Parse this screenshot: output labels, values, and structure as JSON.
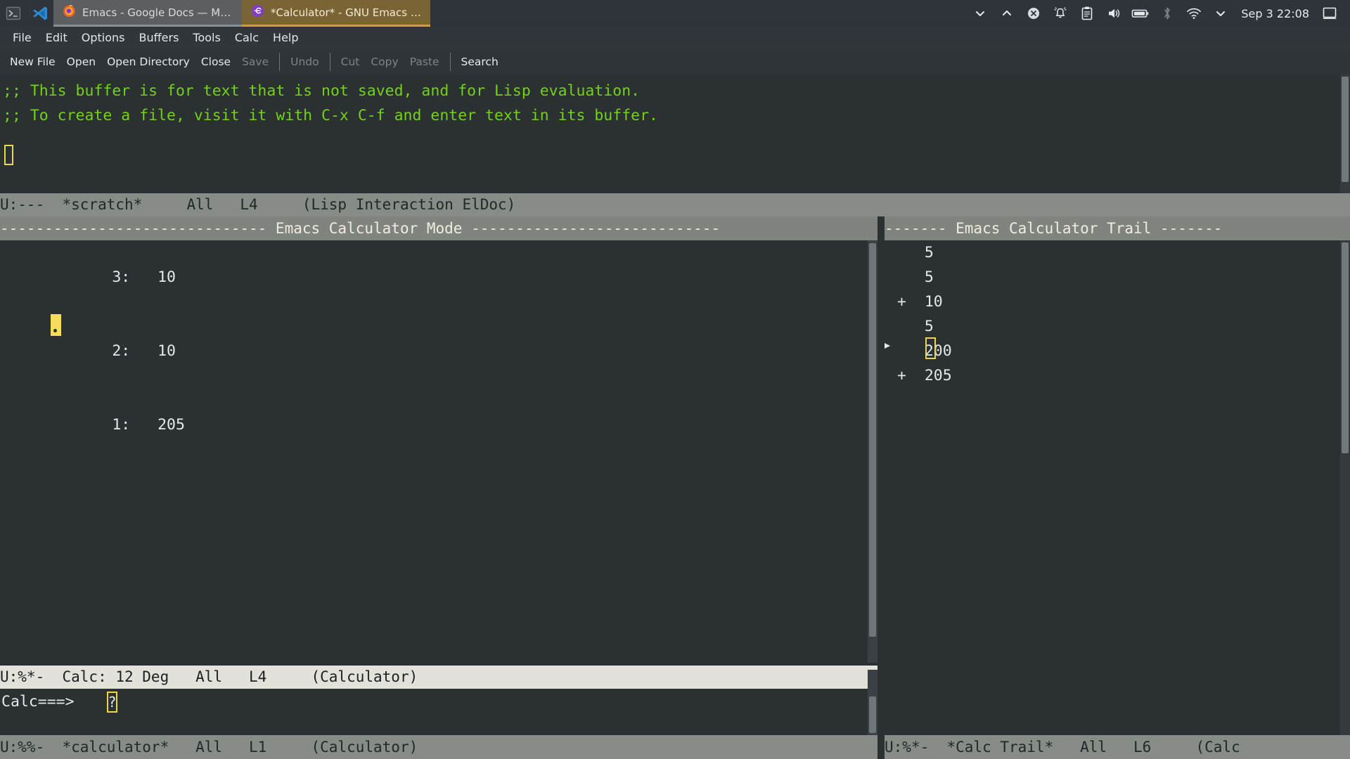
{
  "taskbar": {
    "launchers": [
      {
        "name": "terminal-launcher-icon",
        "label": "Terminal"
      },
      {
        "name": "vscode-launcher-icon",
        "label": "Visual Studio Code"
      }
    ],
    "windows": [
      {
        "name": "taskbar-window-firefox",
        "icon": "firefox-icon",
        "title": "Emacs - Google Docs — Mozi...",
        "active": false
      },
      {
        "name": "taskbar-window-emacs",
        "icon": "emacs-icon",
        "title": "*Calculator* - GNU Emacs at...",
        "active": true
      }
    ],
    "tray": [
      {
        "name": "chevron-down-icon",
        "glyph": "chevron-down"
      },
      {
        "name": "chevron-up-icon",
        "glyph": "chevron-up"
      },
      {
        "name": "close-circle-icon",
        "glyph": "x-circle"
      },
      {
        "name": "bell-icon",
        "glyph": "bell"
      },
      {
        "name": "clipboard-icon",
        "glyph": "clipboard"
      },
      {
        "name": "volume-icon",
        "glyph": "speaker"
      },
      {
        "name": "battery-icon",
        "glyph": "battery"
      },
      {
        "name": "bluetooth-icon",
        "glyph": "bluetooth"
      },
      {
        "name": "wifi-icon",
        "glyph": "wifi"
      },
      {
        "name": "tray-chevron-down-icon",
        "glyph": "chevron-down"
      }
    ],
    "clock": "Sep 3 22:08",
    "show_desktop": "show-desktop-icon",
    "colors": {
      "bar_bg": "#2f343a",
      "active_tab_bg": "#7a6433",
      "inactive_tab_bg": "#5b5f62"
    }
  },
  "menubar": {
    "items": [
      {
        "name": "menu-file",
        "label": "File"
      },
      {
        "name": "menu-edit",
        "label": "Edit"
      },
      {
        "name": "menu-options",
        "label": "Options"
      },
      {
        "name": "menu-buffers",
        "label": "Buffers"
      },
      {
        "name": "menu-tools",
        "label": "Tools"
      },
      {
        "name": "menu-calc",
        "label": "Calc"
      },
      {
        "name": "menu-help",
        "label": "Help"
      }
    ]
  },
  "toolbar": {
    "items": [
      {
        "name": "toolbar-new-file",
        "label": "New File",
        "disabled": false,
        "sep_after": false
      },
      {
        "name": "toolbar-open",
        "label": "Open",
        "disabled": false,
        "sep_after": false
      },
      {
        "name": "toolbar-open-directory",
        "label": "Open Directory",
        "disabled": false,
        "sep_after": false
      },
      {
        "name": "toolbar-close",
        "label": "Close",
        "disabled": false,
        "sep_after": false
      },
      {
        "name": "toolbar-save",
        "label": "Save",
        "disabled": true,
        "sep_after": true
      },
      {
        "name": "toolbar-undo",
        "label": "Undo",
        "disabled": true,
        "sep_after": true
      },
      {
        "name": "toolbar-cut",
        "label": "Cut",
        "disabled": true,
        "sep_after": false
      },
      {
        "name": "toolbar-copy",
        "label": "Copy",
        "disabled": true,
        "sep_after": false
      },
      {
        "name": "toolbar-paste",
        "label": "Paste",
        "disabled": true,
        "sep_after": true
      },
      {
        "name": "toolbar-search",
        "label": "Search",
        "disabled": false,
        "sep_after": false
      }
    ]
  },
  "scratch": {
    "lines": [
      ";; This buffer is for text that is not saved, and for Lisp evaluation.",
      ";; To create a file, visit it with C-x C-f and enter text in its buffer."
    ],
    "text_color": "#73d216",
    "modeline": {
      "prefix": "U:---",
      "buffer": "*scratch*",
      "position": "All",
      "line": "L4",
      "modes": "(Lisp Interaction ElDoc)",
      "full": "U:---  *scratch*     All   L4     (Lisp Interaction ElDoc)"
    }
  },
  "calc": {
    "header": "------------------------------ Emacs Calculator Mode ----------------------------",
    "stack": [
      {
        "name": "calc-stack-row-3",
        "index": "3:",
        "value": "10"
      },
      {
        "name": "calc-stack-row-2",
        "index": "2:",
        "value": "10"
      },
      {
        "name": "calc-stack-row-1",
        "index": "1:",
        "value": "205"
      }
    ],
    "cursor_char": ".",
    "modeline": {
      "prefix": "U:%*-",
      "label": "Calc: 12 Deg",
      "position": "All",
      "line": "L4",
      "modes": "(Calculator)",
      "full": "U:%*-  Calc: 12 Deg   All   L4     (Calculator)"
    },
    "prompt_label": "Calc===>",
    "prompt_value": "?",
    "buffer_modeline": {
      "prefix": "U:%%-",
      "buffer": "*calculator*",
      "position": "All",
      "line": "L1",
      "modes": "(Calculator)",
      "full": "U:%%-  *calculator*   All   L1     (Calculator)"
    }
  },
  "trail": {
    "header": "------- Emacs Calculator Trail -------",
    "rows": [
      {
        "name": "trail-row-1",
        "op": "",
        "value": "5"
      },
      {
        "name": "trail-row-2",
        "op": "",
        "value": "5"
      },
      {
        "name": "trail-row-3",
        "op": "+",
        "value": "10"
      },
      {
        "name": "trail-row-4",
        "op": "",
        "value": "5"
      },
      {
        "name": "trail-row-5",
        "op": "",
        "value": "200"
      },
      {
        "name": "trail-row-6",
        "op": "+",
        "value": "205"
      }
    ],
    "marker": "▶",
    "modeline": {
      "prefix": "U:%*-",
      "buffer": "*Calc Trail*",
      "position": "All",
      "line": "L6",
      "modes": "(Calc",
      "full": "U:%*-  *Calc Trail*   All   L6     (Calc"
    }
  }
}
